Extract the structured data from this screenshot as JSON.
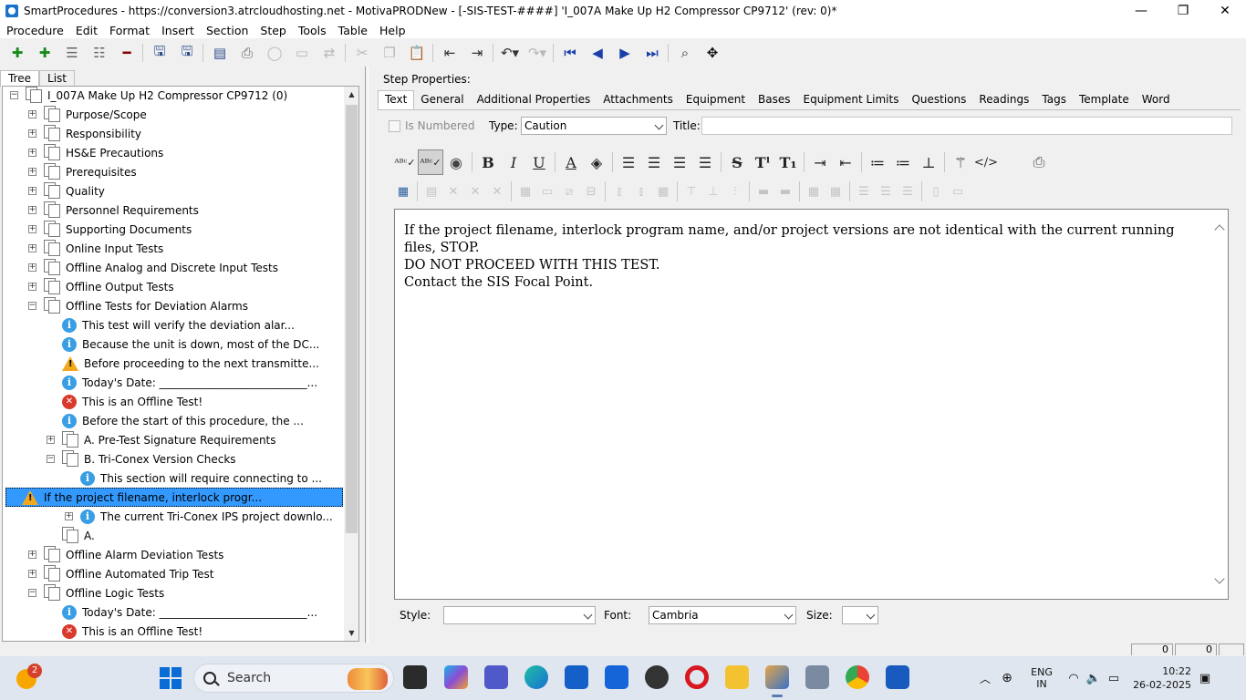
{
  "window": {
    "title": "SmartProcedures - https://conversion3.atrcloudhosting.net - MotivaPRODNew - [-SIS-TEST-####] 'I_007A Make Up H2 Compressor CP9712' (rev: 0)*",
    "minimize": "—",
    "maximize": "❐",
    "close": "✕"
  },
  "menu": [
    "Procedure",
    "Edit",
    "Format",
    "Insert",
    "Section",
    "Step",
    "Tools",
    "Table",
    "Help"
  ],
  "left_tabs": [
    "Tree",
    "List"
  ],
  "tree": [
    {
      "label": "I_007A Make Up H2 Compressor CP9712 (0)",
      "indent": 0,
      "exp": "−",
      "icon": "doc"
    },
    {
      "label": "Purpose/Scope",
      "indent": 1,
      "exp": "+",
      "icon": "doc"
    },
    {
      "label": "Responsibility",
      "indent": 1,
      "exp": "+",
      "icon": "doc"
    },
    {
      "label": "HS&E Precautions",
      "indent": 1,
      "exp": "+",
      "icon": "doc"
    },
    {
      "label": "Prerequisites",
      "indent": 1,
      "exp": "+",
      "icon": "doc"
    },
    {
      "label": "Quality",
      "indent": 1,
      "exp": "+",
      "icon": "doc"
    },
    {
      "label": "Personnel Requirements",
      "indent": 1,
      "exp": "+",
      "icon": "doc"
    },
    {
      "label": "Supporting Documents",
      "indent": 1,
      "exp": "+",
      "icon": "doc"
    },
    {
      "label": "Online Input Tests",
      "indent": 1,
      "exp": "+",
      "icon": "doc"
    },
    {
      "label": "Offline Analog and Discrete Input Tests",
      "indent": 1,
      "exp": "+",
      "icon": "doc"
    },
    {
      "label": "Offline Output Tests",
      "indent": 1,
      "exp": "+",
      "icon": "doc"
    },
    {
      "label": "Offline Tests for Deviation Alarms",
      "indent": 1,
      "exp": "−",
      "icon": "doc"
    },
    {
      "label": "This test will verify the deviation alar...",
      "indent": 2,
      "exp": "",
      "icon": "info"
    },
    {
      "label": "Because the unit is down, most of the DC...",
      "indent": 2,
      "exp": "",
      "icon": "info"
    },
    {
      "label": "Before proceeding to the next transmitte...",
      "indent": 2,
      "exp": "",
      "icon": "warn"
    },
    {
      "label": "Today's Date: ___________________________...",
      "indent": 2,
      "exp": "",
      "icon": "info"
    },
    {
      "label": "This is an Offline Test!",
      "indent": 2,
      "exp": "",
      "icon": "err"
    },
    {
      "label": "Before the start of this procedure, the ...",
      "indent": 2,
      "exp": "",
      "icon": "info"
    },
    {
      "label": "A. Pre-Test Signature Requirements",
      "indent": 2,
      "exp": "+",
      "icon": "doc"
    },
    {
      "label": "B. Tri-Conex Version Checks",
      "indent": 2,
      "exp": "−",
      "icon": "doc"
    },
    {
      "label": "This section will require connecting to ...",
      "indent": 3,
      "exp": "",
      "icon": "info"
    },
    {
      "label": "If the project filename, interlock progr...",
      "indent": 3,
      "exp": "",
      "icon": "warn",
      "selected": true
    },
    {
      "label": "The current Tri-Conex IPS project downlo...",
      "indent": 3,
      "exp": "+",
      "icon": "info"
    },
    {
      "label": "A.",
      "indent": 2,
      "exp": "",
      "icon": "doc"
    },
    {
      "label": "Offline Alarm Deviation Tests",
      "indent": 1,
      "exp": "+",
      "icon": "doc"
    },
    {
      "label": "Offline Automated Trip Test",
      "indent": 1,
      "exp": "+",
      "icon": "doc"
    },
    {
      "label": "Offline Logic Tests",
      "indent": 1,
      "exp": "−",
      "icon": "doc"
    },
    {
      "label": "Today's Date: ___________________________...",
      "indent": 2,
      "exp": "",
      "icon": "info"
    },
    {
      "label": "This is an Offline Test!",
      "indent": 2,
      "exp": "",
      "icon": "err"
    }
  ],
  "step_properties": {
    "heading": "Step Properties:",
    "tabs": [
      "Text",
      "General",
      "Additional Properties",
      "Attachments",
      "Equipment",
      "Bases",
      "Equipment Limits",
      "Questions",
      "Readings",
      "Tags",
      "Template",
      "Word"
    ],
    "is_numbered_label": "Is Numbered",
    "type_label": "Type:",
    "type_value": "Caution",
    "title_label": "Title:",
    "title_value": ""
  },
  "editor": {
    "lines": [
      "If the project filename, interlock program name, and/or project versions are not identical with the current running files, STOP.",
      "DO NOT PROCEED WITH THIS TEST.",
      "Contact the SIS Focal Point."
    ]
  },
  "bottom": {
    "style_label": "Style:",
    "style_value": "",
    "font_label": "Font:",
    "font_value": "Cambria",
    "size_label": "Size:",
    "size_value": ""
  },
  "status": {
    "pane1": "0",
    "pane2": "0"
  },
  "taskbar": {
    "weather_badge": "2",
    "search_placeholder": "Search",
    "lang_line1": "ENG",
    "lang_line2": "IN",
    "time": "10:22",
    "date": "26-02-2025"
  },
  "colors": {
    "selection": "#3399ff",
    "info": "#3a9ee4",
    "warn": "#f2a81c",
    "error": "#d83a2e"
  }
}
